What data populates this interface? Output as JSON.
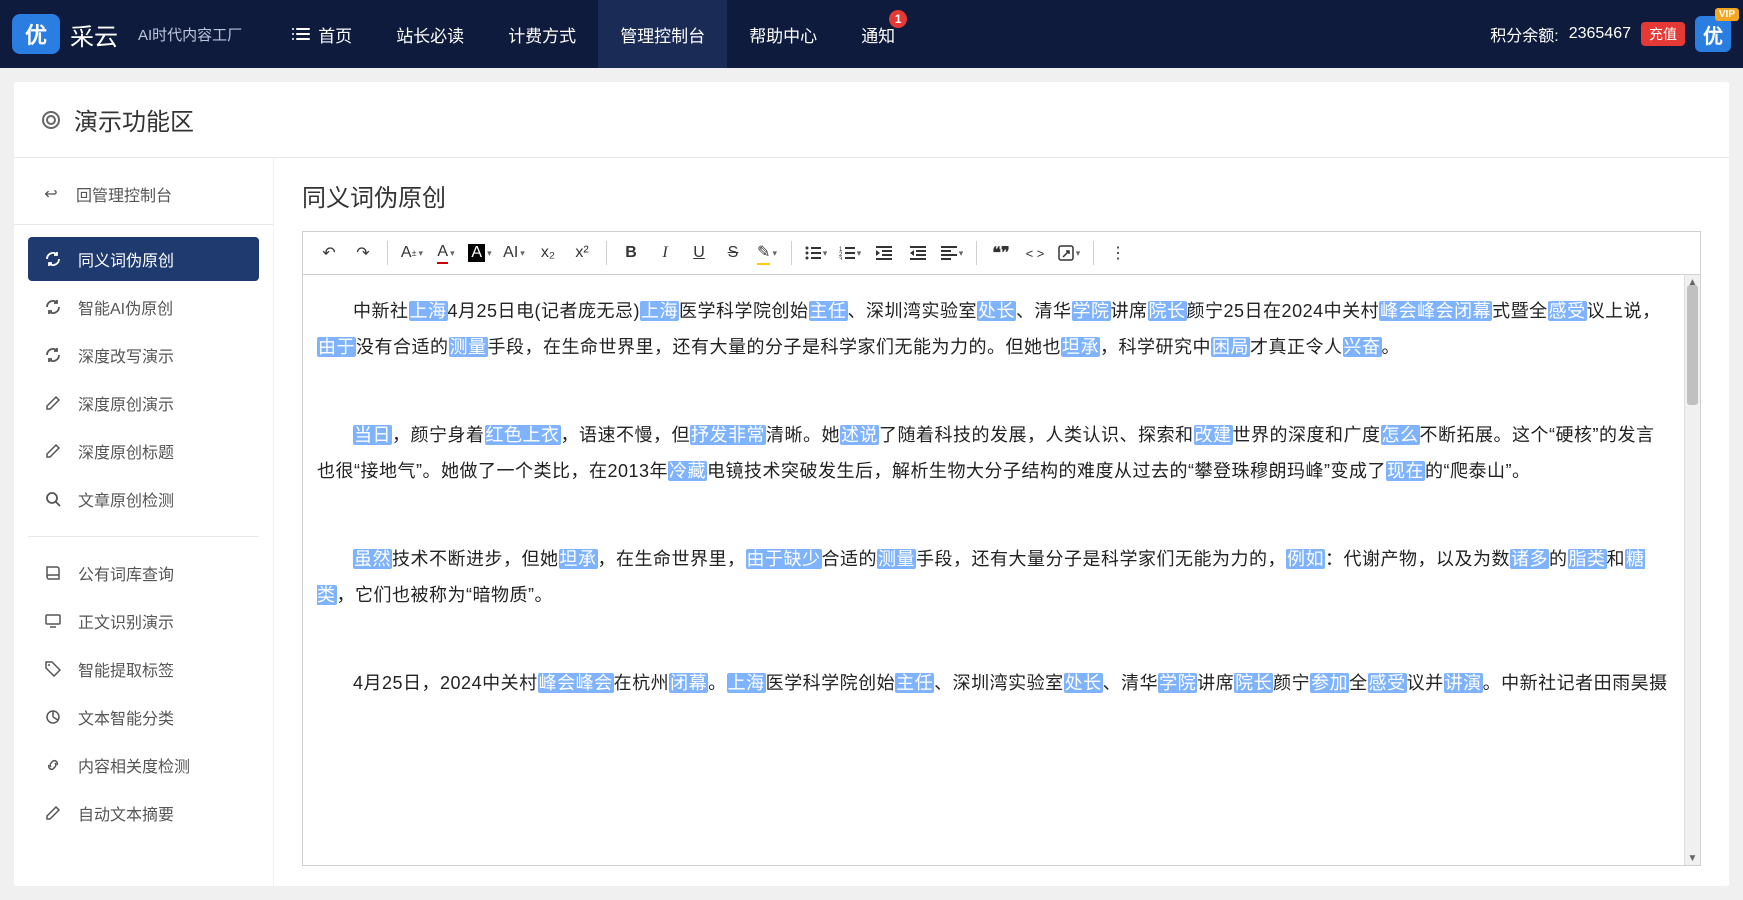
{
  "topbar": {
    "brand": "采云",
    "slogan": "AI时代内容工厂",
    "nav": [
      {
        "label": "首页"
      },
      {
        "label": "站长必读"
      },
      {
        "label": "计费方式"
      },
      {
        "label": "管理控制台"
      },
      {
        "label": "帮助中心"
      },
      {
        "label": "通知",
        "badge": "1"
      }
    ],
    "points_label": "积分余额:",
    "points_value": "2365467",
    "recharge": "充值",
    "vip": "VIP",
    "logo_char": "优",
    "avatar_char": "优"
  },
  "panel": {
    "title": "演示功能区",
    "back": "回管理控制台"
  },
  "sidebar": {
    "group1": [
      {
        "icon": "refresh",
        "label": "同义词伪原创",
        "active": true
      },
      {
        "icon": "refresh",
        "label": "智能AI伪原创"
      },
      {
        "icon": "refresh",
        "label": "深度改写演示"
      },
      {
        "icon": "edit",
        "label": "深度原创演示"
      },
      {
        "icon": "edit",
        "label": "深度原创标题"
      },
      {
        "icon": "search",
        "label": "文章原创检测"
      }
    ],
    "group2": [
      {
        "icon": "book",
        "label": "公有词库查询"
      },
      {
        "icon": "screen",
        "label": "正文识别演示"
      },
      {
        "icon": "tag",
        "label": "智能提取标签"
      },
      {
        "icon": "pie",
        "label": "文本智能分类"
      },
      {
        "icon": "link",
        "label": "内容相关度检测"
      },
      {
        "icon": "edit",
        "label": "自动文本摘要"
      }
    ]
  },
  "content": {
    "title": "同义词伪原创",
    "paragraphs": [
      [
        {
          "t": "中新社"
        },
        {
          "t": "上海",
          "h": 1
        },
        {
          "t": "4月25日电(记者庞无忌)"
        },
        {
          "t": "上海",
          "h": 1
        },
        {
          "t": "医学科学院创始"
        },
        {
          "t": "主任",
          "h": 1
        },
        {
          "t": "、深圳湾实验室"
        },
        {
          "t": "处长",
          "h": 1
        },
        {
          "t": "、清华"
        },
        {
          "t": "学院",
          "h": 1
        },
        {
          "t": "讲席"
        },
        {
          "t": "院长",
          "h": 1
        },
        {
          "t": "颜宁25日在2024中关村"
        },
        {
          "t": "峰会峰会闭幕",
          "h": 1
        },
        {
          "t": "式暨全"
        },
        {
          "t": "感受",
          "h": 1
        },
        {
          "t": "议上说，"
        },
        {
          "t": "由于",
          "h": 1
        },
        {
          "t": "没有合适的"
        },
        {
          "t": "测量",
          "h": 1
        },
        {
          "t": "手段，在生命世界里，还有大量的分子是科学家们无能为力的。但她也"
        },
        {
          "t": "坦承",
          "h": 1
        },
        {
          "t": "，科学研究中"
        },
        {
          "t": "困局",
          "h": 1
        },
        {
          "t": "才真正令人"
        },
        {
          "t": "兴奋",
          "h": 1
        },
        {
          "t": "。"
        }
      ],
      [
        {
          "t": "当日",
          "h": 1
        },
        {
          "t": "，颜宁身着"
        },
        {
          "t": "红色上衣",
          "h": 1
        },
        {
          "t": "，语速不慢，但"
        },
        {
          "t": "抒发非常",
          "h": 1
        },
        {
          "t": "清晰。她"
        },
        {
          "t": "述说",
          "h": 1
        },
        {
          "t": "了随着科技的发展，人类认识、探索和"
        },
        {
          "t": "改建",
          "h": 1
        },
        {
          "t": "世界的深度和广度"
        },
        {
          "t": "怎么",
          "h": 1
        },
        {
          "t": "不断拓展。这个“硬核”的发言也很“接地气”。她做了一个类比，在2013年"
        },
        {
          "t": "冷藏",
          "h": 1
        },
        {
          "t": "电镜技术突破发生后，解析生物大分子结构的难度从过去的“攀登珠穆朗玛峰”变成了"
        },
        {
          "t": "现在",
          "h": 1
        },
        {
          "t": "的“爬泰山”。"
        }
      ],
      [
        {
          "t": "虽然",
          "h": 1
        },
        {
          "t": "技术不断进步，但她"
        },
        {
          "t": "坦承",
          "h": 1
        },
        {
          "t": "，在生命世界里，"
        },
        {
          "t": "由于缺少",
          "h": 1
        },
        {
          "t": "合适的"
        },
        {
          "t": "测量",
          "h": 1
        },
        {
          "t": "手段，还有大量分子是科学家们无能为力的，"
        },
        {
          "t": "例如",
          "h": 1
        },
        {
          "t": "：代谢产物，以及为数"
        },
        {
          "t": "诸多",
          "h": 1
        },
        {
          "t": "的"
        },
        {
          "t": "脂类",
          "h": 1
        },
        {
          "t": "和"
        },
        {
          "t": "糖类",
          "h": 1
        },
        {
          "t": "，它们也被称为“暗物质”。"
        }
      ],
      [
        {
          "t": "4月25日，2024中关村"
        },
        {
          "t": "峰会峰会",
          "h": 1
        },
        {
          "t": "在杭州"
        },
        {
          "t": "闭幕",
          "h": 1
        },
        {
          "t": "。"
        },
        {
          "t": "上海",
          "h": 1
        },
        {
          "t": "医学科学院创始"
        },
        {
          "t": "主任",
          "h": 1
        },
        {
          "t": "、深圳湾实验室"
        },
        {
          "t": "处长",
          "h": 1
        },
        {
          "t": "、清华"
        },
        {
          "t": "学院",
          "h": 1
        },
        {
          "t": "讲席"
        },
        {
          "t": "院长",
          "h": 1
        },
        {
          "t": "颜宁"
        },
        {
          "t": "参加",
          "h": 1
        },
        {
          "t": "全"
        },
        {
          "t": "感受",
          "h": 1
        },
        {
          "t": "议并"
        },
        {
          "t": "讲演",
          "h": 1
        },
        {
          "t": "。中新社记者田雨昊摄"
        }
      ]
    ]
  },
  "toolbar_icons": {
    "undo": "↶",
    "redo": "↷",
    "fontsize": "A",
    "fontcolor": "A",
    "bgcolor": "A",
    "letterspace": "AI",
    "sub": "x₂",
    "sup": "x²",
    "bold": "B",
    "italic": "I",
    "underline": "U",
    "strike": "S",
    "highlight": "✎",
    "quote": "❝❞",
    "code": "< >",
    "more": "⋮"
  }
}
